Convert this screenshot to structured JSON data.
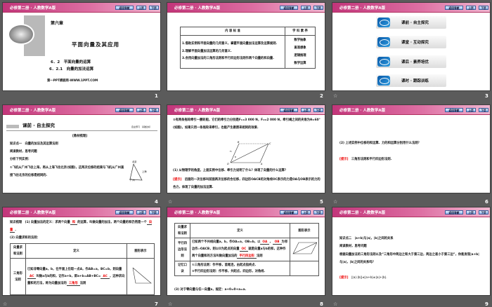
{
  "header": {
    "title": "必修第二册 · 人教数学A版",
    "nav_back": "返回导航",
    "nav_prev": "上页",
    "nav_next": "下页"
  },
  "slides": [
    {
      "number": "1",
      "chapter": "第六章",
      "title": "平面向量及其应用",
      "section": "6．2　平面向量的运算",
      "subsection": "6．2.1　向量的加法运算",
      "footer": "第一PPT模板网-WWW.1PPT.COM"
    },
    {
      "number": "2",
      "table": {
        "headers": [
          "内 容 标 准",
          "学 科 素 养"
        ],
        "content": [
          "1.借助实例和平面向量的几何意义，掌握平面向量加法运算及运算规则.",
          "2.理解平面向量加法运算的几何意义.",
          "3.会用向量加法的三角形法则和平行四边形法则作两个向量的和向量."
        ],
        "literacy": [
          "数学抽象",
          "直观想象",
          "逻辑推理",
          "数学运算"
        ]
      }
    },
    {
      "number": "3",
      "menu": [
        "课前 · 自主探究",
        "课堂 · 互动探究",
        "课后 · 素养培优",
        "课时 · 跟踪训练"
      ]
    },
    {
      "number": "4",
      "section": "课前 · 自主探究",
      "tag": "自主预习　基础达标",
      "heading": "[教材梳理]",
      "lines": [
        "知识点一　向量的加法及其运算法则",
        "阅读教材，思考问题",
        "分析下列实例：",
        "①飞机从广州飞往上海，再从上海飞往北京(如图)，这两次位移的结果与飞机从广州直接飞往北京的位移是相同的."
      ],
      "map": [
        "北京",
        "上海",
        "广州"
      ]
    },
    {
      "number": "5",
      "text": "②有两条拖轮牵引一艘轮船，它们的牵引力分别是F₁=3 000 N，F₂=2 000 N，牵引绳之间的夹角为θ=60°(如图)，如果只用一条拖轮来牵引，也能产生跟原来相同的效果.",
      "labels": [
        "O",
        "A",
        "B",
        "C",
        "F₁",
        "F₂",
        "θ"
      ],
      "question": "(1) 从物理学的角度，上面实例中位移、牵引力说明了什么？体现了向量的什么运算？",
      "hint_label": "[提示]",
      "hint": "后面的一次位移叫前面两次位移的合位移，四边形OACB的对角线OC表示的力是OA与OB表示的力的合力，体现了向量的加法运算."
    },
    {
      "number": "6",
      "question": "(2) 上述实例中位移的和运算、力的和运算分别用什么法则？",
      "hint_label": "[提示]",
      "hint": "三角形法则和平行四边形法则."
    },
    {
      "number": "7",
      "l1a": "知识梳理　(1) 向量加法的定义：求两个向量",
      "b1": "和",
      "l1b": "的运算，叫做向量的加法，两个向量的和仍然是一个",
      "b2": "向量",
      "l2": "(2) 向量求和的法则：",
      "headers": [
        "向量求和法则",
        "定义",
        "图形表示"
      ],
      "rule": "三角形法则",
      "d1": "已知非零向量a，b，在平面上任取一点A，作AB=a，BC=b，则向量",
      "b3": "AC",
      "d2": "叫做a与b的和，记作a+b，即a+b=AB+BC=",
      "b4": "AC",
      "d3": "，这种求向量和的方法，称为向量加法的",
      "b5": "三角形",
      "d4": "法则"
    },
    {
      "number": "8",
      "headers": [
        "向量求和法则",
        "定义",
        "图形表示"
      ],
      "rule": "平行四边形法则",
      "d1": "已知两个不共线向量a，b，作OA=a，OB=b，以",
      "b1": "OA",
      "b2": "OB",
      "d2": "为邻边作▱OACB，则以O为起点的向量",
      "b3": "OC",
      "d3": "就是向量a与b的和，这种作两个向量和的方法叫做向量加法的",
      "b4": "平行四边形",
      "d4": "法则",
      "memo_label": "记忆口诀",
      "memo": [
        "①三角形法则：作平移，首尾连，由起点指终点.",
        "②平行四边形法则：作平移，共起点，四边形，对角线."
      ],
      "note": "(3) 对于零向量与任一向量a，规定：a+0=0+a=a."
    },
    {
      "number": "9",
      "lines": [
        "知识点二　|a+b|与|a|，|b|之间的关系",
        "阅读教材，思考问题",
        "根据向量加法的三角形法则以及“三角形中两边之和大于第三边，两边之差小于第三边”，你能发现|a+b|与|a|，|b|之间的关系吗？"
      ],
      "hint_label": "[提示]",
      "hint": "||a|-|b||≤|a+b|≤|a|+|b|."
    }
  ],
  "star_icon": "☆"
}
